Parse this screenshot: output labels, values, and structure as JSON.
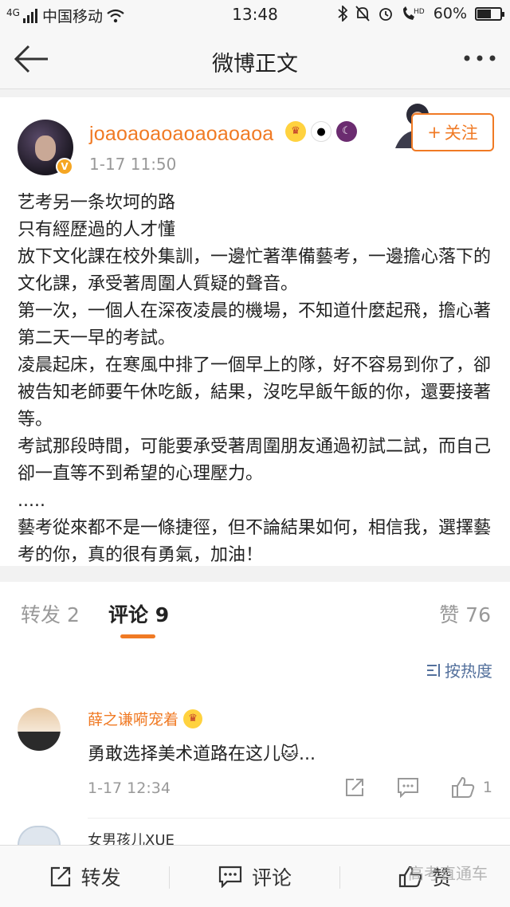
{
  "status_bar": {
    "signal": "4G",
    "carrier": "中国移动",
    "time": "13:48",
    "icons": [
      "bluetooth-icon",
      "mute-icon",
      "alarm-icon",
      "hd-call-icon"
    ],
    "battery": "60%",
    "battery_level": 0.6
  },
  "nav": {
    "title": "微博正文"
  },
  "post": {
    "username": "joaoaoaoaoaoaoaoa",
    "time": "1-17 11:50",
    "follow_label": "关注",
    "paragraphs": [
      "艺考另一条坎坷的路",
      "只有經歷過的人才懂",
      "放下文化課在校外集訓，一邊忙著準備藝考，一邊擔心落下的文化課，承受著周圍人質疑的聲音。",
      "第一次，一個人在深夜凌晨的機場，不知道什麼起飛，擔心著第二天一早的考試。",
      "凌晨起床，在寒風中排了一個早上的隊，好不容易到你了，卻被告知老師要午休吃飯，結果，沒吃早飯午飯的你，還要接著等。",
      "考試那段時間，可能要承受著周圍朋友通過初試二試，而自己卻一直等不到希望的心理壓力。",
      ".....",
      "藝考從來都不是一條捷徑，但不論結果如何，相信我，選擇藝考的你，真的很有勇氣，加油！"
    ]
  },
  "tabs": {
    "repost": "转发 2",
    "comment": "评论 9",
    "like": "赞 76",
    "sort": "按热度"
  },
  "comments": [
    {
      "name": "薛之谦嗬宠着",
      "text": "勇敢选择美术道路在这儿",
      "time": "1-17 12:34",
      "likes": "1"
    },
    {
      "name": "女男孩儿XUE"
    }
  ],
  "bottom_bar": {
    "repost": "转发",
    "comment": "评论",
    "like": "赞"
  },
  "watermark": "高考直通车",
  "colors": {
    "accent": "#f07a24",
    "link": "#53709c"
  }
}
